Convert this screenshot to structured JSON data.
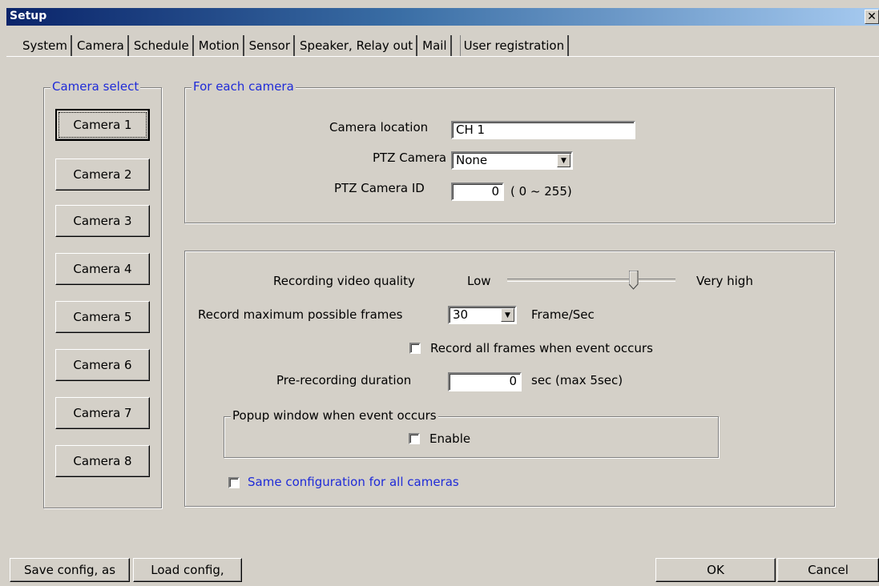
{
  "window": {
    "title": "Setup",
    "close_glyph": "✕"
  },
  "tabs": [
    {
      "label": "System",
      "active": false
    },
    {
      "label": "Camera",
      "active": true
    },
    {
      "label": "Schedule",
      "active": false
    },
    {
      "label": "Motion",
      "active": false
    },
    {
      "label": "Sensor",
      "active": false
    },
    {
      "label": "Speaker, Relay out",
      "active": false
    },
    {
      "label": "Mail",
      "active": false
    },
    {
      "label": "User registration",
      "active": false
    }
  ],
  "camera_select": {
    "legend": "Camera select",
    "buttons": [
      "Camera 1",
      "Camera 2",
      "Camera 3",
      "Camera 4",
      "Camera 5",
      "Camera 6",
      "Camera 7",
      "Camera 8"
    ],
    "selected": "Camera 1"
  },
  "per_camera": {
    "legend": "For each camera",
    "location_label": "Camera location",
    "location_value": "CH 1",
    "ptz_label": "PTZ Camera",
    "ptz_value": "None",
    "ptz_id_label": "PTZ Camera ID",
    "ptz_id_value": "0",
    "ptz_id_range": "( 0 ~ 255)"
  },
  "recording": {
    "quality_label": "Recording video quality",
    "quality_low": "Low",
    "quality_high": "Very high",
    "quality_level": 0.75,
    "frames_label": "Record maximum possible frames",
    "frames_value": "30",
    "frames_unit": "Frame/Sec",
    "record_all_label": "Record all frames when event occurs",
    "record_all_checked": false,
    "prerec_label": "Pre-recording duration",
    "prerec_value": "0",
    "prerec_unit": "sec (max 5sec)",
    "popup_legend": "Popup window when event occurs",
    "popup_enable_label": "Enable",
    "popup_enable_checked": false,
    "same_config_label": "Same configuration for all cameras",
    "same_config_checked": false
  },
  "footer": {
    "save_label": "Save config, as",
    "load_label": "Load config,",
    "ok_label": "OK",
    "cancel_label": "Cancel"
  },
  "colors": {
    "title_start": "#0a246a",
    "face": "#d4d0c8",
    "link_blue": "#1f2bd8"
  }
}
